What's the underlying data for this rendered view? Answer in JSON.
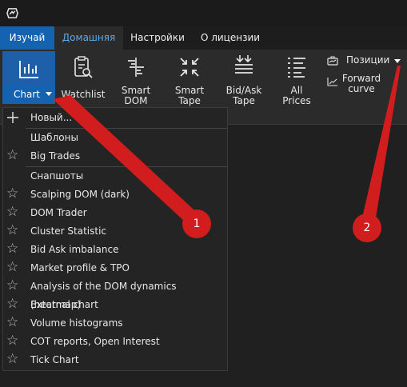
{
  "tabs": {
    "learn": "Изучай",
    "home": "Домашняя",
    "settings": "Настройки",
    "about": "О лицензии"
  },
  "ribbon": {
    "chart": "Chart",
    "watchlist": "Watchlist",
    "smart_dom_1": "Smart",
    "smart_dom_2": "DOM",
    "smart_tape_1": "Smart",
    "smart_tape_2": "Tape",
    "bidask_1": "Bid/Ask",
    "bidask_2": "Tape",
    "allprices_1": "All",
    "allprices_2": "Prices",
    "positions": "Позиции",
    "forward_1": "Forward",
    "forward_2": "curve"
  },
  "menu": {
    "new": "Новый...",
    "templates_header": "Шаблоны",
    "big_trades": "Big Trades",
    "snapshots_header": "Снапшоты",
    "items": [
      "Scalping DOM (dark)",
      "DOM Trader",
      "Cluster Statistic",
      "Bid Ask imbalance",
      "Market profile & TPO",
      "Analysis of the DOM dynamics (heatmap)",
      "External chart",
      "Volume histograms",
      "COT reports, Open Interest",
      "Tick Chart"
    ]
  },
  "annotations": {
    "badge1": "1",
    "badge2": "2"
  },
  "colors": {
    "accent": "#1462b0",
    "annotation": "#d11d1d"
  }
}
